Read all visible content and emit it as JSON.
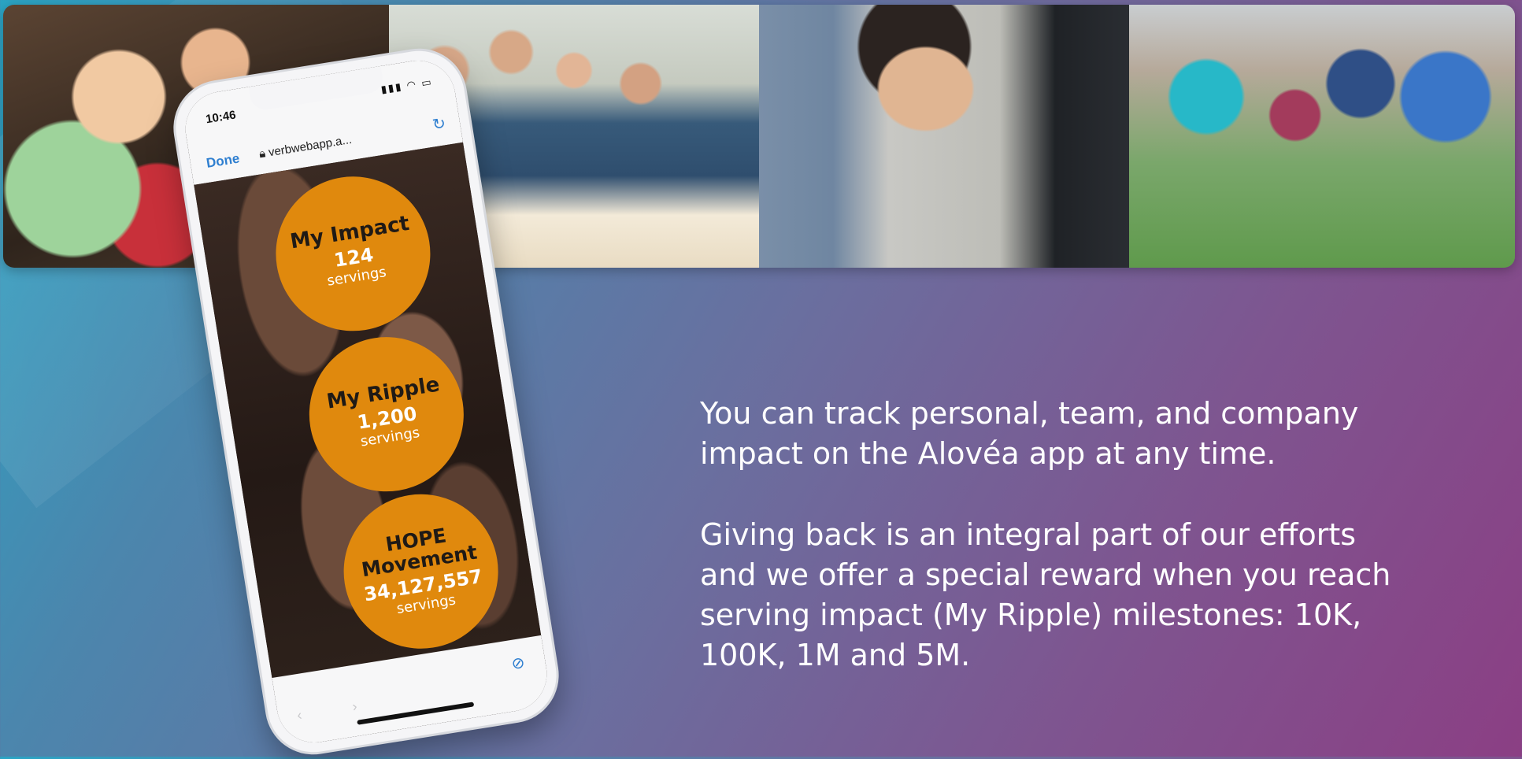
{
  "photos": [
    {
      "subject": "children-group-photo"
    },
    {
      "subject": "volunteers-and-children-photo"
    },
    {
      "subject": "girl-holding-meal-pack-photo"
    },
    {
      "subject": "volunteers-with-girls-photo"
    }
  ],
  "phone": {
    "time": "10:46",
    "status_icons": "signal-wifi-battery",
    "done_label": "Done",
    "url": "verbwebapp.a...",
    "lock_icon": "lock-icon",
    "refresh_icon": "refresh-icon",
    "compass_icon": "compass-icon",
    "impact_circles": [
      {
        "title": "My Impact",
        "value": "124",
        "unit": "servings"
      },
      {
        "title": "My Ripple",
        "value": "1,200",
        "unit": "servings"
      },
      {
        "title": "HOPE Movement",
        "value": "34,127,557",
        "unit": "servings"
      }
    ],
    "accent_color": "#e0890d"
  },
  "copy": {
    "paragraph_1": "You can track personal, team, and company impact on the Alovéa app at any time.",
    "paragraph_2": "Giving back is an integral part of our efforts and we offer a special reward when you reach serving impact (My Ripple) milestones: 10K, 100K, 1M and 5M."
  }
}
